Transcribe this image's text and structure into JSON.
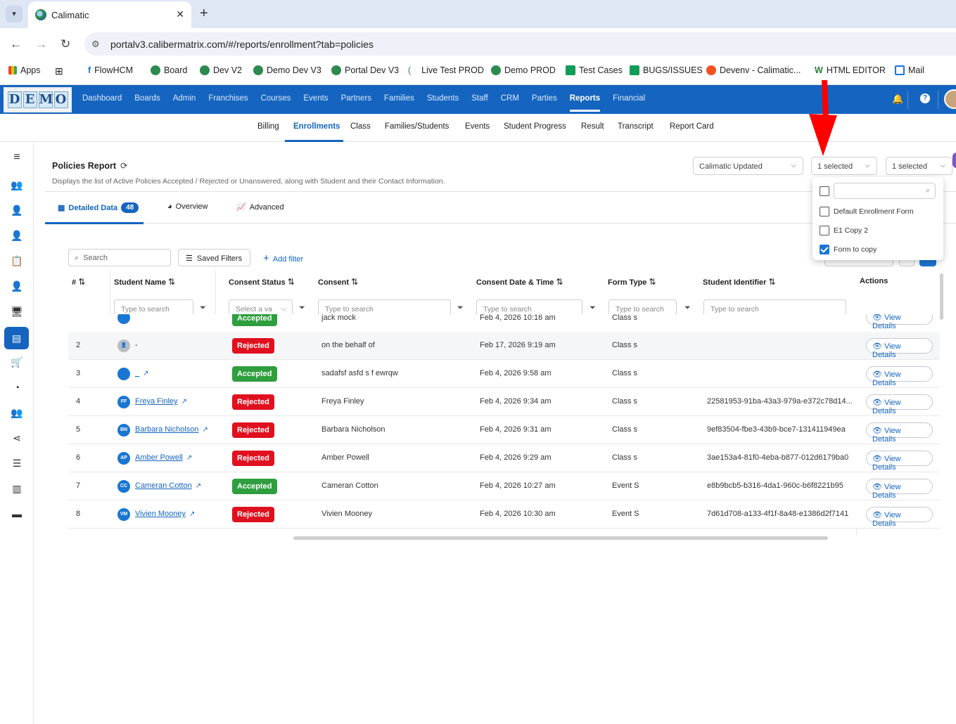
{
  "browser": {
    "tab_title": "Calimatic",
    "url": "portalv3.calibermatrix.com/#/reports/enrollment?tab=policies",
    "bookmarks": [
      {
        "label": "Apps",
        "color": "#ea4335"
      },
      {
        "label": "",
        "color": "#444"
      },
      {
        "label": "FlowHCM",
        "color": "#1a73e8"
      },
      {
        "label": "Board",
        "color": "#2d8a4e"
      },
      {
        "label": "Dev V2",
        "color": "#2d8a4e"
      },
      {
        "label": "Demo Dev V3",
        "color": "#2d8a4e"
      },
      {
        "label": "Portal Dev V3",
        "color": "#2d8a4e"
      },
      {
        "label": "Live Test PROD",
        "color": "#2d8a4e"
      },
      {
        "label": "Demo PROD",
        "color": "#2d8a4e"
      },
      {
        "label": "Test Cases",
        "color": "#0f9d58"
      },
      {
        "label": "BUGS/ISSUES",
        "color": "#0f9d58"
      },
      {
        "label": "Devenv - Calimatic...",
        "color": "#f4511e"
      },
      {
        "label": "HTML EDITOR",
        "color": "#2e7d32"
      },
      {
        "label": "Mail",
        "color": "#1a73e8"
      }
    ]
  },
  "app": {
    "logo_letters": [
      "D",
      "E",
      "M",
      "O"
    ],
    "topnav": [
      "Dashboard",
      "Boards",
      "Admin",
      "Franchises",
      "Courses",
      "Events",
      "Partners",
      "Families",
      "Students",
      "Staff",
      "CRM",
      "Parties",
      "Reports",
      "Financial"
    ],
    "topnav_active": "Reports",
    "subnav": [
      "Billing",
      "Enrollments",
      "Class",
      "Families/Students",
      "Events",
      "Student Progress",
      "Result",
      "Transcript",
      "Report Card"
    ],
    "subnav_active": "Enrollments",
    "accent": "#1565c0"
  },
  "report": {
    "title": "Policies Report",
    "description": "Displays the list of Active Policies Accepted / Rejected or Unanswered, along with Student and their Contact Information.",
    "franchise_select": "Calimatic Updated",
    "form_select": "1 selected",
    "other_select": "1 selected",
    "tabs": [
      {
        "label": "Detailed Data",
        "badge": "48"
      },
      {
        "label": "Overview"
      },
      {
        "label": "Advanced"
      }
    ],
    "search_placeholder": "Search",
    "saved_filters": "Saved Filters",
    "add_filter": "Add filter"
  },
  "dropdown": {
    "options": [
      {
        "label": "Default Enrollment Form",
        "checked": false
      },
      {
        "label": "E1 Copy 2",
        "checked": false
      },
      {
        "label": "Form to copy",
        "checked": true
      }
    ]
  },
  "table": {
    "headers": {
      "num": "#",
      "name": "Student Name",
      "status": "Consent Status",
      "consent": "Consent",
      "date": "Consent Date & Time",
      "form": "Form Type",
      "identifier": "Student Identifier",
      "actions": "Actions"
    },
    "filter_placeholder": "Type to search",
    "select_placeholder": "Select a va",
    "view_label": "View Details",
    "rows": [
      {
        "n": "",
        "initials": "",
        "name": "",
        "status": "Accepted",
        "consent": "jack mock",
        "date": "Feb 4, 2026 10:16 am",
        "form": "Class s",
        "identifier": ""
      },
      {
        "n": "2",
        "initials": "",
        "name": "-",
        "status": "Rejected",
        "consent": "on the behalf of",
        "date": "Feb 17, 2026 9:19 am",
        "form": "Class s",
        "identifier": ""
      },
      {
        "n": "3",
        "initials": "",
        "name": "_",
        "status": "Accepted",
        "consent": "sadafsf asfd s f ewrqw",
        "date": "Feb 4, 2026 9:58 am",
        "form": "Class s",
        "identifier": ""
      },
      {
        "n": "4",
        "initials": "FF",
        "name": "Freya Finley",
        "status": "Rejected",
        "consent": "Freya Finley",
        "date": "Feb 4, 2026 9:34 am",
        "form": "Class s",
        "identifier": "22581953-91ba-43a3-979a-e372c78d14..."
      },
      {
        "n": "5",
        "initials": "BN",
        "name": "Barbara Nicholson",
        "status": "Rejected",
        "consent": "Barbara Nicholson",
        "date": "Feb 4, 2026 9:31 am",
        "form": "Class s",
        "identifier": "9ef83504-fbe3-43b9-bce7-131411949ea"
      },
      {
        "n": "6",
        "initials": "AP",
        "name": "Amber Powell",
        "status": "Rejected",
        "consent": "Amber Powell",
        "date": "Feb 4, 2026 9:29 am",
        "form": "Class s",
        "identifier": "3ae153a4-81f0-4eba-b877-012d6179ba0"
      },
      {
        "n": "7",
        "initials": "CC",
        "name": "Cameran Cotton",
        "status": "Accepted",
        "consent": "Cameran Cotton",
        "date": "Feb 4, 2026 10:27 am",
        "form": "Event S",
        "identifier": "e8b9bcb5-b316-4da1-960c-b6f8221b95"
      },
      {
        "n": "8",
        "initials": "VM",
        "name": "Vivien Mooney",
        "status": "Rejected",
        "consent": "Vivien Mooney",
        "date": "Feb 4, 2026 10:30 am",
        "form": "Event S",
        "identifier": "7d61d708-a133-4f1f-8a48-e1386d2f7141"
      }
    ]
  }
}
